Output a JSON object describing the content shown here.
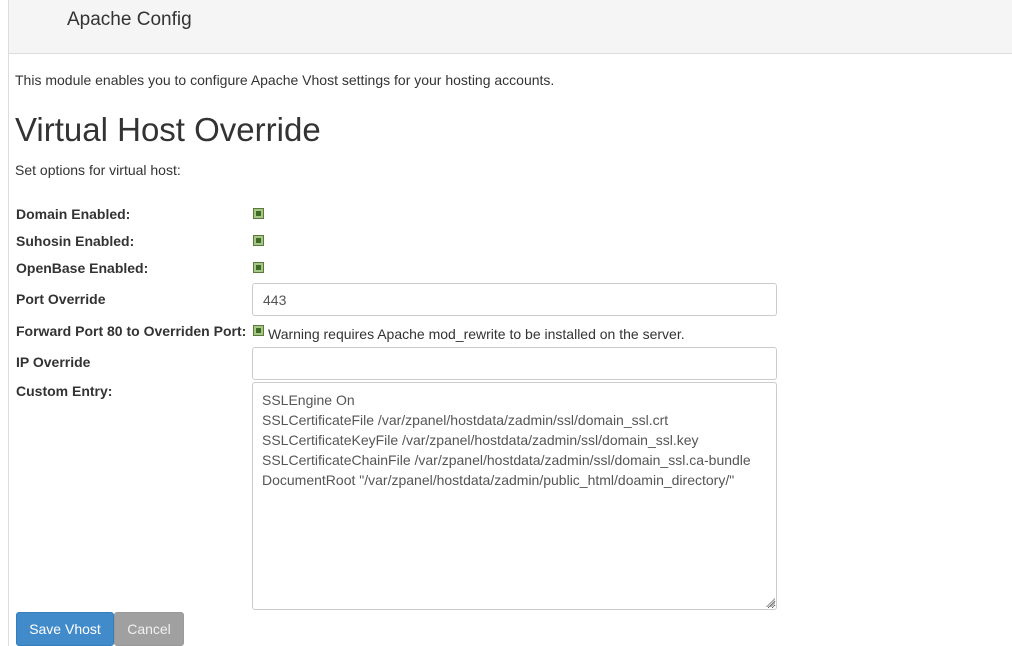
{
  "header": {
    "title": "Apache Config"
  },
  "intro": "This module enables you to configure Apache Vhost settings for your hosting accounts.",
  "section": {
    "title": "Virtual Host Override",
    "subtitle": "Set options for virtual host:"
  },
  "form": {
    "domain_enabled": {
      "label": "Domain Enabled:",
      "checked": true
    },
    "suhosin_enabled": {
      "label": "Suhosin Enabled:",
      "checked": true
    },
    "openbase_enabled": {
      "label": "OpenBase Enabled:",
      "checked": true
    },
    "port_override": {
      "label": "Port Override",
      "value": "443"
    },
    "forward_port": {
      "label": "Forward Port 80 to Overriden Port:",
      "checked": true,
      "warning": "Warning requires Apache mod_rewrite to be installed on the server."
    },
    "ip_override": {
      "label": "IP Override",
      "value": ""
    },
    "custom_entry": {
      "label": "Custom Entry:",
      "value": "SSLEngine On\nSSLCertificateFile /var/zpanel/hostdata/zadmin/ssl/domain_ssl.crt\nSSLCertificateKeyFile /var/zpanel/hostdata/zadmin/ssl/domain_ssl.key\nSSLCertificateChainFile /var/zpanel/hostdata/zadmin/ssl/domain_ssl.ca-bundle\nDocumentRoot \"/var/zpanel/hostdata/zadmin/public_html/doamin_directory/\""
    }
  },
  "buttons": {
    "save": "Save Vhost",
    "cancel": "Cancel"
  },
  "colors": {
    "primary": "#428bca",
    "cancel": "#a0a0a0",
    "checkbox": "#a7c78a"
  }
}
